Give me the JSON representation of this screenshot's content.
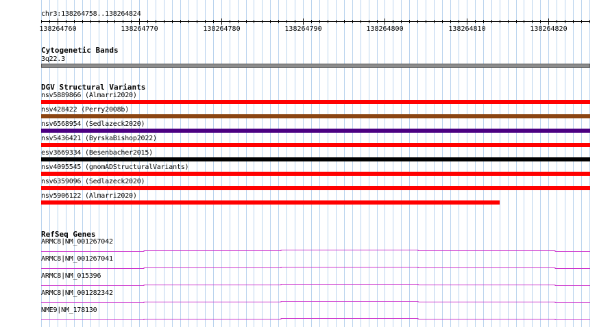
{
  "region": {
    "label": "chr3:138264758..138264824",
    "start": 138264758,
    "end": 138264824
  },
  "ruler": {
    "ticks": [
      "138264760",
      "138264770",
      "138264780",
      "138264790",
      "138264800",
      "138264810",
      "138264820"
    ]
  },
  "tracks": {
    "cytobands": {
      "title": "Cytogenetic Bands",
      "band_label": "3q22.3",
      "band_color": "#8c8c8c"
    },
    "dgv": {
      "title": "DGV Structural Variants",
      "features": [
        {
          "label": "nsv5889866 (Almarri2020)",
          "color": "#ff0000",
          "end": 138264824
        },
        {
          "label": "nsv428422 (Perry2008b)",
          "color": "#8b4513",
          "end": 138264824
        },
        {
          "label": "nsv6568954 (Sedlazeck2020)",
          "color": "#4b0082",
          "end": 138264824
        },
        {
          "label": "nsv5436421 (ByrskaBishop2022)",
          "color": "#ff0000",
          "end": 138264824
        },
        {
          "label": "esv3669334 (Besenbacher2015)",
          "color": "#000000",
          "end": 138264824
        },
        {
          "label": "nsv4095545 (gnomADStructuralVariants)",
          "color": "#ff0000",
          "end": 138264824
        },
        {
          "label": "nsv6359096 (Sedlazeck2020)",
          "color": "#ff0000",
          "end": 138264824
        },
        {
          "label": "nsv5906122 (Almarri2020)",
          "color": "#ff0000",
          "end": 138264813
        }
      ]
    },
    "refseq": {
      "title": "RefSeq Genes",
      "line_color": "#cc33cc",
      "genes": [
        {
          "label": "ARMC8|NM_001267042"
        },
        {
          "label": "ARMC8|NM_001267041"
        },
        {
          "label": "ARMC8|NM_015396"
        },
        {
          "label": "ARMC8|NM_001282342"
        },
        {
          "label": "NME9|NM_178130"
        }
      ]
    }
  },
  "colors": {
    "grid_line": "#b9d3ee",
    "ruler": "#000000"
  }
}
